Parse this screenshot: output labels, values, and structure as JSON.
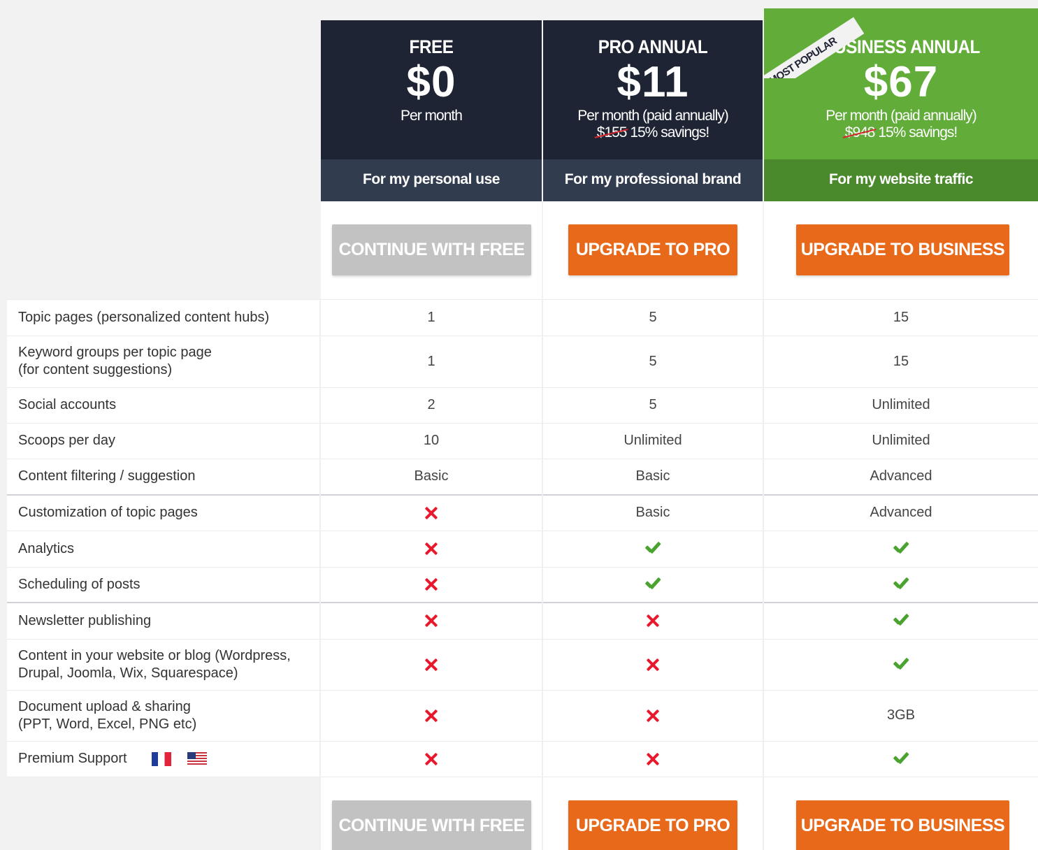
{
  "plans": [
    {
      "name": "FREE",
      "price": "$0",
      "per": "Per month",
      "old_price": "",
      "savings": "",
      "tagline": "For my personal use",
      "button": "CONTINUE WITH FREE"
    },
    {
      "name": "PRO ANNUAL",
      "price": "$11",
      "per": "Per month (paid annually)",
      "old_price": "$155",
      "savings": "15% savings!",
      "tagline": "For my professional brand",
      "button": "UPGRADE TO PRO"
    },
    {
      "name": "BUSINESS ANNUAL",
      "price": "$67",
      "per": "Per month (paid annually)",
      "old_price": "$948",
      "savings": "15% savings!",
      "tagline": "For my website traffic",
      "button": "UPGRADE TO BUSINESS",
      "ribbon": "MOST POPULAR"
    }
  ],
  "colors": {
    "dark_header": "#1e2433",
    "dark_tagline": "#323c4f",
    "green_header": "#62ad3a",
    "green_tagline": "#4a8a2c",
    "orange_button": "#e8691a",
    "gray_button": "#c2c2c2",
    "cross": "#e8192c",
    "check": "#4aa32f"
  },
  "features": [
    {
      "label": "Topic pages (personalized content hubs)",
      "values": [
        "1",
        "5",
        "15"
      ]
    },
    {
      "label": "Keyword groups per topic page\n(for content suggestions)",
      "values": [
        "1",
        "5",
        "15"
      ]
    },
    {
      "label": "Social accounts",
      "values": [
        "2",
        "5",
        "Unlimited"
      ]
    },
    {
      "label": "Scoops per day",
      "values": [
        "10",
        "Unlimited",
        "Unlimited"
      ]
    },
    {
      "label": "Content filtering / suggestion",
      "values": [
        "Basic",
        "Basic",
        "Advanced"
      ]
    },
    {
      "label": "Customization of topic pages",
      "values": [
        "x",
        "Basic",
        "Advanced"
      ]
    },
    {
      "label": "Analytics",
      "values": [
        "x",
        "check",
        "check"
      ]
    },
    {
      "label": "Scheduling of posts",
      "values": [
        "x",
        "check",
        "check"
      ]
    },
    {
      "label": "Newsletter publishing",
      "values": [
        "x",
        "x",
        "check"
      ]
    },
    {
      "label": "Content in your website or blog (Wordpress,\nDrupal, Joomla, Wix, Squarespace)",
      "values": [
        "x",
        "x",
        "check"
      ]
    },
    {
      "label": "Document upload & sharing\n(PPT, Word, Excel, PNG etc)",
      "values": [
        "x",
        "x",
        "3GB"
      ]
    },
    {
      "label": "Premium Support",
      "values": [
        "x",
        "x",
        "check"
      ],
      "icons": [
        "france-flag-icon",
        "usa-flag-icon"
      ]
    }
  ]
}
